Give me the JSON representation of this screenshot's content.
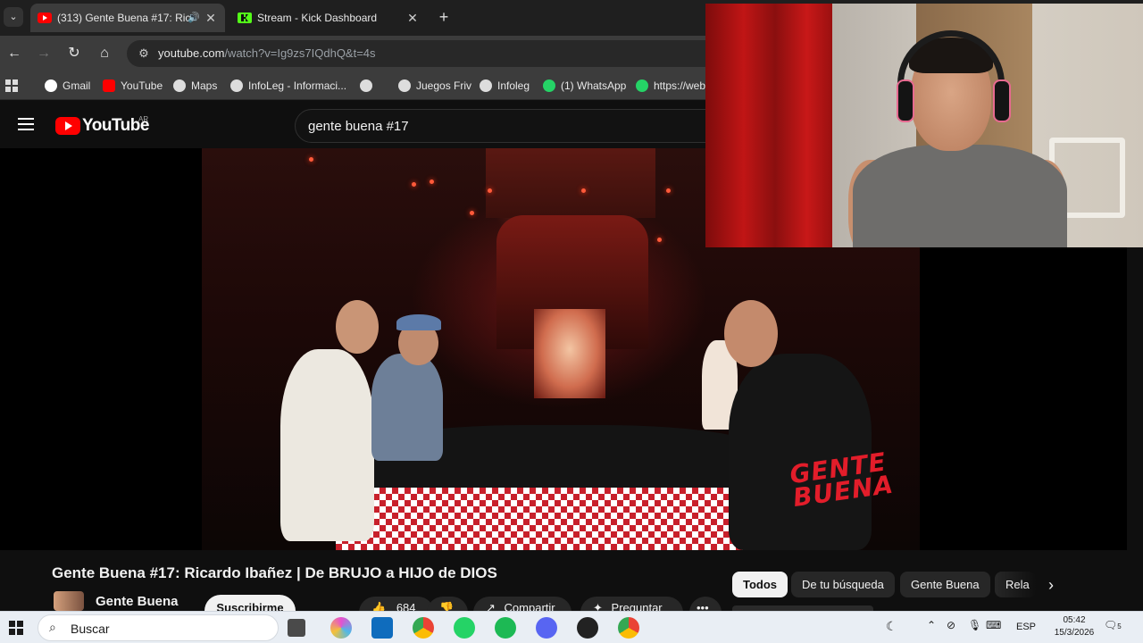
{
  "browser": {
    "tabs": [
      {
        "title": "(313) Gente Buena #17: Rica",
        "audio_icon": "speaker-icon",
        "active": true
      },
      {
        "title": "Stream - Kick Dashboard",
        "active": false
      }
    ],
    "new_tab_icon": "plus-icon",
    "url_host": "youtube.com",
    "url_path": "/watch?v=Ig9zs7IQdhQ&t=4s",
    "bookmarks": [
      {
        "label": "Gmail",
        "icon": "gmail-icon",
        "color": "#ea4335"
      },
      {
        "label": "YouTube",
        "icon": "youtube-icon",
        "color": "#ff0000"
      },
      {
        "label": "Maps",
        "icon": "globe-icon",
        "color": "#cccccc"
      },
      {
        "label": "InfoLeg - Informaci...",
        "icon": "globe-icon",
        "color": "#cccccc"
      },
      {
        "label": "",
        "icon": "globe-icon",
        "color": "#cccccc"
      },
      {
        "label": "Juegos Friv",
        "icon": "globe-icon",
        "color": "#cccccc"
      },
      {
        "label": "Infoleg",
        "icon": "globe-icon",
        "color": "#cccccc"
      },
      {
        "label": "(1) WhatsApp",
        "icon": "whatsapp-icon",
        "color": "#25d366"
      },
      {
        "label": "https://web",
        "icon": "whatsapp-icon",
        "color": "#25d366"
      }
    ]
  },
  "youtube": {
    "logo_text": "YouTube",
    "country_code": "AR",
    "search_query": "gente buena #17",
    "video": {
      "brand_overlay": "GENTE BUENA",
      "title": "Gente Buena #17: Ricardo Ibañez | De BRUJO a HIJO de DIOS",
      "channel": "Gente Buena",
      "subscribe_label": "Suscribirme",
      "likes": "684",
      "share_label": "Compartir",
      "ask_label": "Preguntar",
      "more_label": "•••"
    },
    "chips": [
      "Todos",
      "De tu búsqueda",
      "Gente Buena",
      "Rela"
    ]
  },
  "taskbar": {
    "search_placeholder": "Buscar",
    "language": "ESP",
    "time": "05:42",
    "date": "15/3/2026",
    "notification_count": "5"
  }
}
